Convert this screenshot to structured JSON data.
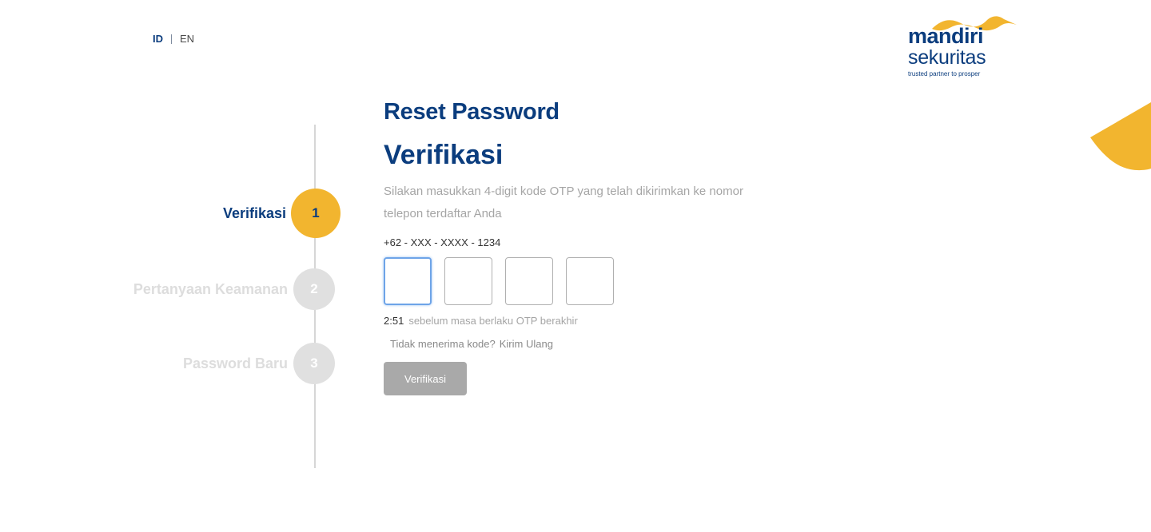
{
  "language": {
    "active": "ID",
    "inactive": "EN"
  },
  "logo": {
    "brand": "mandiri",
    "sub": "sekuritas",
    "tagline": "trusted partner to prosper"
  },
  "colors": {
    "brand_blue": "#0b3d7e",
    "accent_yellow": "#f2b52f",
    "disabled_gray": "#a9a9a9"
  },
  "steps": [
    {
      "label": "Verifikasi",
      "number": "1",
      "state": "active"
    },
    {
      "label": "Pertanyaan Keamanan",
      "number": "2",
      "state": "inactive"
    },
    {
      "label": "Password Baru",
      "number": "3",
      "state": "inactive"
    }
  ],
  "form": {
    "title": "Reset Password",
    "heading": "Verifikasi",
    "description": "Silakan masukkan 4-digit kode OTP yang telah dikirimkan ke nomor telepon terdaftar Anda",
    "phone": "+62 - XXX - XXXX - 1234",
    "otp_values": [
      "",
      "",
      "",
      ""
    ],
    "timer_value": "2:51",
    "timer_text": "sebelum masa berlaku OTP berakhir",
    "resend_question": "Tidak menerima kode?",
    "resend_link": "Kirim Ulang",
    "submit_label": "Verifikasi"
  }
}
